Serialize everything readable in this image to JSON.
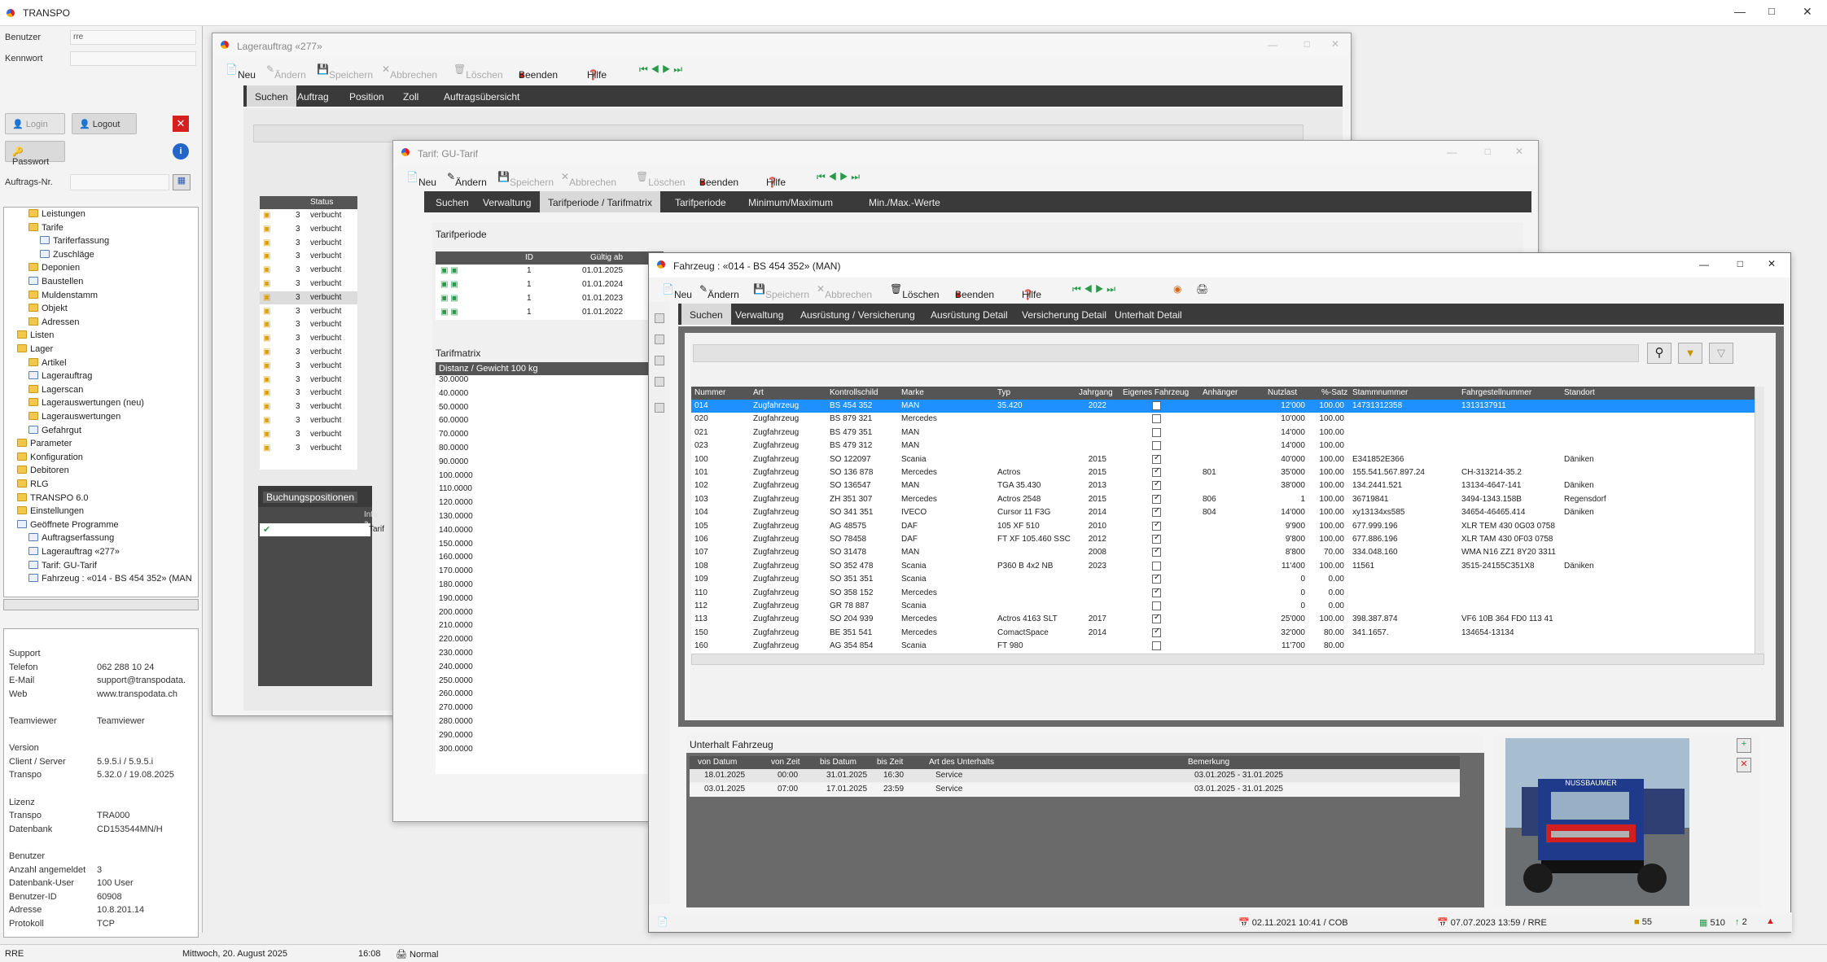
{
  "app": {
    "title": "TRANSPO"
  },
  "login": {
    "user_label": "Benutzer",
    "user_value": "rre",
    "pass_label": "Kennwort",
    "login_btn": "Login",
    "logout_btn": "Logout",
    "password_btn": "Passwort",
    "order_label": "Auftrags-Nr."
  },
  "tree": [
    {
      "label": "Leistungen",
      "lvl": 2,
      "t": "f"
    },
    {
      "label": "Tarife",
      "lvl": 2,
      "t": "f"
    },
    {
      "label": "Tariferfassung",
      "lvl": 3,
      "t": "d"
    },
    {
      "label": "Zuschläge",
      "lvl": 3,
      "t": "d"
    },
    {
      "label": "Deponien",
      "lvl": 2,
      "t": "f"
    },
    {
      "label": "Baustellen",
      "lvl": 2,
      "t": "d"
    },
    {
      "label": "Muldenstamm",
      "lvl": 2,
      "t": "f"
    },
    {
      "label": "Objekt",
      "lvl": 2,
      "t": "f"
    },
    {
      "label": "Adressen",
      "lvl": 2,
      "t": "f"
    },
    {
      "label": "Listen",
      "lvl": 1,
      "t": "f"
    },
    {
      "label": "Lager",
      "lvl": 1,
      "t": "f"
    },
    {
      "label": "Artikel",
      "lvl": 2,
      "t": "f"
    },
    {
      "label": "Lagerauftrag",
      "lvl": 2,
      "t": "d"
    },
    {
      "label": "Lagerscan",
      "lvl": 2,
      "t": "f"
    },
    {
      "label": "Lagerauswertungen (neu)",
      "lvl": 2,
      "t": "f"
    },
    {
      "label": "Lagerauswertungen",
      "lvl": 2,
      "t": "f"
    },
    {
      "label": "Gefahrgut",
      "lvl": 2,
      "t": "d"
    },
    {
      "label": "Parameter",
      "lvl": 1,
      "t": "f"
    },
    {
      "label": "Konfiguration",
      "lvl": 1,
      "t": "f"
    },
    {
      "label": "Debitoren",
      "lvl": 1,
      "t": "f"
    },
    {
      "label": "RLG",
      "lvl": 1,
      "t": "f"
    },
    {
      "label": "TRANSPO 6.0",
      "lvl": 1,
      "t": "f"
    },
    {
      "label": "Einstellungen",
      "lvl": 1,
      "t": "f"
    },
    {
      "label": "Geöffnete Programme",
      "lvl": 1,
      "t": "d"
    },
    {
      "label": "Auftragserfassung",
      "lvl": 2,
      "t": "d"
    },
    {
      "label": "Lagerauftrag «277»",
      "lvl": 2,
      "t": "d"
    },
    {
      "label": "Tarif: GU-Tarif",
      "lvl": 2,
      "t": "d"
    },
    {
      "label": "Fahrzeug : «014 - BS 454 352» (MAN",
      "lvl": 2,
      "t": "d"
    }
  ],
  "info": [
    {
      "k": "Support",
      "v": ""
    },
    {
      "k": "Telefon",
      "v": "062 288 10 24"
    },
    {
      "k": "E-Mail",
      "v": "support@transpodata."
    },
    {
      "k": "Web",
      "v": "www.transpodata.ch"
    },
    {
      "k": "",
      "v": ""
    },
    {
      "k": "Teamviewer",
      "v": "Teamviewer"
    },
    {
      "k": "",
      "v": ""
    },
    {
      "k": "Version",
      "v": ""
    },
    {
      "k": "Client / Server",
      "v": "5.9.5.i / 5.9.5.i"
    },
    {
      "k": "Transpo",
      "v": "5.32.0 / 19.08.2025"
    },
    {
      "k": "",
      "v": ""
    },
    {
      "k": "Lizenz",
      "v": ""
    },
    {
      "k": "Transpo",
      "v": "TRA000"
    },
    {
      "k": "Datenbank",
      "v": "CD153544MN/H"
    },
    {
      "k": "",
      "v": ""
    },
    {
      "k": "Benutzer",
      "v": ""
    },
    {
      "k": "Anzahl angemeldet",
      "v": "3"
    },
    {
      "k": "Datenbank-User",
      "v": "100 User"
    },
    {
      "k": "Benutzer-ID",
      "v": "60908"
    },
    {
      "k": "Adresse",
      "v": "10.8.201.14"
    },
    {
      "k": "Protokoll",
      "v": "TCP"
    }
  ],
  "status": {
    "user": "RRE",
    "date": "Mittwoch, 20. August 2025",
    "time": "16:08",
    "mode": "Normal"
  },
  "toolbar": {
    "new": "Neu",
    "edit": "Ändern",
    "save": "Speichern",
    "cancel": "Abbrechen",
    "delete": "Löschen",
    "close": "Beenden",
    "help": "Hilfe"
  },
  "win1": {
    "title": "Lagerauftrag «277»",
    "tabs": [
      "Suchen",
      "Auftrag",
      "Position",
      "Zoll",
      "Auftragsübersicht"
    ],
    "col_status": "Status",
    "rows": [
      "verbucht",
      "verbucht",
      "verbucht",
      "verbucht",
      "verbucht",
      "verbucht",
      "verbucht",
      "verbucht",
      "verbucht",
      "verbucht",
      "verbucht",
      "verbucht",
      "verbucht",
      "verbucht",
      "verbucht",
      "verbucht",
      "verbucht",
      "verbucht"
    ],
    "row_num": "3",
    "bp_tab": "Buchungspositionen",
    "bp_col": "Info a",
    "bp_val": "Tarif"
  },
  "win2": {
    "title": "Tarif: GU-Tarif",
    "tabs": [
      "Suchen",
      "Verwaltung",
      "Tarifperiode / Tarifmatrix",
      "Tarifperiode",
      "Minimum/Maximum",
      "Min./Max.-Werte"
    ],
    "tp_label": "Tarifperiode",
    "tp_cols": [
      "ID",
      "Gültig ab"
    ],
    "tp_rows": [
      [
        "1",
        "01.01.2025"
      ],
      [
        "1",
        "01.01.2024"
      ],
      [
        "1",
        "01.01.2023"
      ],
      [
        "1",
        "01.01.2022"
      ]
    ],
    "tm_label": "Tarifmatrix",
    "tm_head": "Distanz / Gewicht 100 kg",
    "tm_rows": [
      "30.0000",
      "40.0000",
      "50.0000",
      "60.0000",
      "70.0000",
      "80.0000",
      "90.0000",
      "100.0000",
      "110.0000",
      "120.0000",
      "130.0000",
      "140.0000",
      "150.0000",
      "160.0000",
      "170.0000",
      "180.0000",
      "190.0000",
      "200.0000",
      "210.0000",
      "220.0000",
      "230.0000",
      "240.0000",
      "250.0000",
      "260.0000",
      "270.0000",
      "280.0000",
      "290.0000",
      "300.0000"
    ]
  },
  "win3": {
    "title": "Fahrzeug : «014 - BS 454 352» (MAN)",
    "tabs": [
      "Suchen",
      "Verwaltung",
      "Ausrüstung / Versicherung",
      "Ausrüstung Detail",
      "Versicherung Detail",
      "Unterhalt Detail"
    ],
    "cols": [
      "Nummer",
      "Art",
      "Kontrollschild",
      "Marke",
      "Typ",
      "Jahrgang",
      "Eigenes Fahrzeug",
      "Anhänger",
      "Nutzlast",
      "%-Satz",
      "Stammnummer",
      "Fahrgestellnummer",
      "Standort"
    ],
    "rows": [
      [
        "014",
        "Zugfahrzeug",
        "BS 454 352",
        "MAN",
        "35.420",
        "2022",
        false,
        "",
        "12'000",
        "100.00",
        "14731312358",
        "1313137911",
        ""
      ],
      [
        "020",
        "Zugfahrzeug",
        "BS 879 321",
        "Mercedes",
        "",
        "",
        false,
        "",
        "10'000",
        "100.00",
        "",
        "",
        ""
      ],
      [
        "021",
        "Zugfahrzeug",
        "BS 479 351",
        "MAN",
        "",
        "",
        false,
        "",
        "14'000",
        "100.00",
        "",
        "",
        ""
      ],
      [
        "023",
        "Zugfahrzeug",
        "BS 479 312",
        "MAN",
        "",
        "",
        false,
        "",
        "14'000",
        "100.00",
        "",
        "",
        ""
      ],
      [
        "100",
        "Zugfahrzeug",
        "SO 122097",
        "Scania",
        "",
        "2015",
        true,
        "",
        "40'000",
        "100.00",
        "E341852E366",
        "",
        "Däniken"
      ],
      [
        "101",
        "Zugfahrzeug",
        "SO 136 878",
        "Mercedes",
        "Actros",
        "2015",
        true,
        "801",
        "35'000",
        "100.00",
        "155.541.567.897.24",
        "CH-313214-35.2",
        ""
      ],
      [
        "102",
        "Zugfahrzeug",
        "SO 136547",
        "MAN",
        "TGA 35.430",
        "2013",
        true,
        "",
        "38'000",
        "100.00",
        "134.2441.521",
        "13134-4647-141",
        "Däniken"
      ],
      [
        "103",
        "Zugfahrzeug",
        "ZH 351 307",
        "Mercedes",
        "Actros 2548",
        "2015",
        true,
        "806",
        "1",
        "100.00",
        "36719841",
        "3494-1343.158B",
        "Regensdorf"
      ],
      [
        "104",
        "Zugfahrzeug",
        "SO 341 351",
        "IVECO",
        "Cursor 11 F3G",
        "2014",
        true,
        "804",
        "14'000",
        "100.00",
        "xy13134xs585",
        "34654-46465.414",
        "Däniken"
      ],
      [
        "105",
        "Zugfahrzeug",
        "AG 48575",
        "DAF",
        "105 XF 510",
        "2010",
        true,
        "",
        "9'900",
        "100.00",
        "677.999.196",
        "XLR TEM 430 0G03 0758",
        ""
      ],
      [
        "106",
        "Zugfahrzeug",
        "SO 78458",
        "DAF",
        "FT XF 105.460 SSC",
        "2012",
        true,
        "",
        "9'800",
        "100.00",
        "677.886.196",
        "XLR TAM 430 0F03 0758",
        ""
      ],
      [
        "107",
        "Zugfahrzeug",
        "SO 31478",
        "MAN",
        "",
        "2008",
        true,
        "",
        "8'800",
        "70.00",
        "334.048.160",
        "WMA N16 ZZ1 8Y20 3311",
        ""
      ],
      [
        "108",
        "Zugfahrzeug",
        "SO 352 478",
        "Scania",
        "P360 B 4x2 NB",
        "2023",
        false,
        "",
        "11'400",
        "100.00",
        "11561",
        "3515-24155C351X8",
        "Däniken"
      ],
      [
        "109",
        "Zugfahrzeug",
        "SO 351 351",
        "Scania",
        "",
        "",
        true,
        "",
        "0",
        "0.00",
        "",
        "",
        ""
      ],
      [
        "110",
        "Zugfahrzeug",
        "SO 358 152",
        "Mercedes",
        "",
        "",
        true,
        "",
        "0",
        "0.00",
        "",
        "",
        ""
      ],
      [
        "112",
        "Zugfahrzeug",
        "GR 78 887",
        "Scania",
        "",
        "",
        false,
        "",
        "0",
        "0.00",
        "",
        "",
        ""
      ],
      [
        "113",
        "Zugfahrzeug",
        "SO 204 939",
        "Mercedes",
        "Actros 4163 SLT",
        "2017",
        true,
        "",
        "25'000",
        "100.00",
        "398.387.874",
        "VF6 10B 364 FD0 113 41",
        ""
      ],
      [
        "150",
        "Zugfahrzeug",
        "BE 351 541",
        "Mercedes",
        "ComactSpace",
        "2014",
        true,
        "",
        "32'000",
        "80.00",
        "341.1657.",
        "134654-13134",
        ""
      ],
      [
        "160",
        "Zugfahrzeug",
        "AG 354 854",
        "Scania",
        "FT 980",
        "",
        false,
        "",
        "11'700",
        "80.00",
        "",
        "",
        ""
      ]
    ],
    "uh_label": "Unterhalt Fahrzeug",
    "uh_cols": [
      "von Datum",
      "von Zeit",
      "bis Datum",
      "bis Zeit",
      "Art des Unterhalts",
      "Bemerkung"
    ],
    "uh_rows": [
      [
        "18.01.2025",
        "00:00",
        "31.01.2025",
        "16:30",
        "Service",
        "03.01.2025 - 31.01.2025"
      ],
      [
        "03.01.2025",
        "07:00",
        "17.01.2025",
        "23:59",
        "Service",
        "03.01.2025 - 31.01.2025"
      ]
    ],
    "truck_text": "NUSSBAUMER",
    "status_created": "02.11.2021 10:41 / COB",
    "status_changed": "07.07.2023 13:59 / RRE",
    "status_n1": "55",
    "status_n2": "510",
    "status_n3": "2"
  },
  "colors": {
    "selected": "#1e90ff",
    "dark": "#3a3a3a",
    "grid": "#555555"
  }
}
